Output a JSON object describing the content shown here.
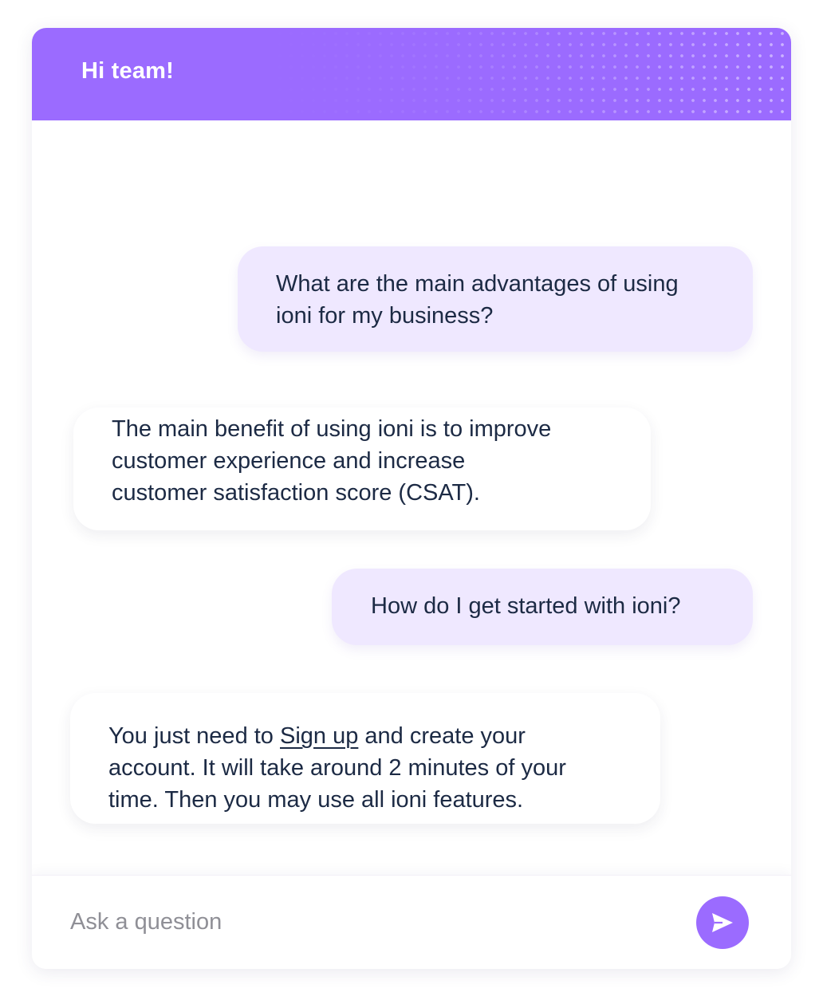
{
  "header": {
    "title": "Hi team!",
    "color": "#9b6bff"
  },
  "messages": [
    {
      "role": "user",
      "lines": [
        "What are the main advantages of using",
        "ioni for my business?"
      ]
    },
    {
      "role": "bot",
      "lines": [
        "The main benefit of using ioni is to improve",
        "customer experience and increase",
        "customer satisfaction score (CSAT)."
      ]
    },
    {
      "role": "user",
      "lines": [
        "How do I get started with ioni?"
      ]
    },
    {
      "role": "bot",
      "line1_before": "You just need to ",
      "line1_link": "Sign up",
      "line1_after": " and create your",
      "lines_rest": [
        "account. It will take around 2 minutes of your",
        "time. Then you may use all ioni features."
      ]
    }
  ],
  "composer": {
    "placeholder": "Ask a question",
    "value": "",
    "send_icon": "send-icon"
  },
  "colors": {
    "accent": "#9b6bff",
    "user_bubble": "#efe8ff",
    "text": "#1c2a44",
    "placeholder": "#8f8f96"
  }
}
